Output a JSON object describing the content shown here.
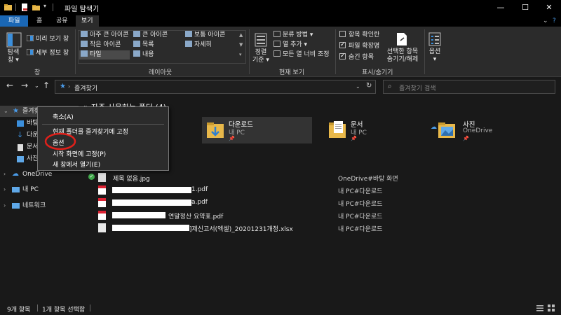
{
  "window": {
    "title": "파일 탐색기",
    "min": "—",
    "max": "☐",
    "close": "✕"
  },
  "ribbon_tabs": [
    "파일",
    "홈",
    "공유",
    "보기"
  ],
  "ribbon": {
    "panes": {
      "nav_pane_label": "탐색\n창 ▾",
      "preview_pane": "미리 보기 창",
      "details_pane": "세부 정보 창",
      "group": "창"
    },
    "layout": {
      "items": [
        "아주 큰 아이콘",
        "큰 아이콘",
        "보통 아이콘",
        "작은 아이콘",
        "목록",
        "자세히",
        "타일",
        "내용"
      ],
      "group": "레이아웃"
    },
    "current_view": {
      "sort_label": "정렬\n기준 ▾",
      "group_by": "분류 방법 ▾",
      "add_column": "열 추가 ▾",
      "fit_columns": "모든 열 너비 조정",
      "group": "현재 보기"
    },
    "show_hide": {
      "item_checkbox": {
        "label": "항목 확인란",
        "checked": false
      },
      "file_ext": {
        "label": "파일 확장명",
        "checked": true
      },
      "hidden_items": {
        "label": "숨긴 항목",
        "checked": true
      },
      "hide_selected": "선택한 항목\n숨기기/해제",
      "group": "표시/숨기기"
    },
    "options": {
      "label": "옵션\n▾"
    }
  },
  "address": {
    "path": "즐겨찾기",
    "search_placeholder": "즐겨찾기 검색"
  },
  "nav_pane": {
    "quick_access": "즐겨찾기",
    "quick_items": [
      "바탕",
      "다운",
      "문서",
      "사진"
    ],
    "onedrive": "OneDrive",
    "this_pc": "내 PC",
    "network": "네트워크"
  },
  "main": {
    "frequent_header": "자주 사용하는 폴더 (4)",
    "folders": [
      {
        "name": "다운로드",
        "location": "내 PC"
      },
      {
        "name": "문서",
        "location": "내 PC"
      },
      {
        "name": "사진",
        "location": "OneDrive"
      }
    ],
    "files": [
      {
        "name": "제목 없음.jpg",
        "location": "OneDrive#바탕 화면"
      },
      {
        "name": "1.pdf",
        "location": "내 PC#다운로드"
      },
      {
        "name": "a.pdf",
        "location": "내 PC#다운로드"
      },
      {
        "name": "연말정산 요약표.pdf",
        "location": "내 PC#다운로드"
      },
      {
        "name": "]제신고서(엑셀)_20201231개정.xlsx",
        "location": "내 PC#다운로드"
      }
    ]
  },
  "context_menu": {
    "items": [
      "축소(A)",
      "현재 폴더를 즐겨찾기에 고정",
      "옵션",
      "시작 화면에 고정(P)",
      "새 창에서 열기(E)"
    ]
  },
  "status": {
    "count": "9개 항목",
    "selected": "1개 항목 선택함"
  },
  "colors": {
    "accent": "#1a67b5",
    "highlight_circle": "#e0201a"
  }
}
